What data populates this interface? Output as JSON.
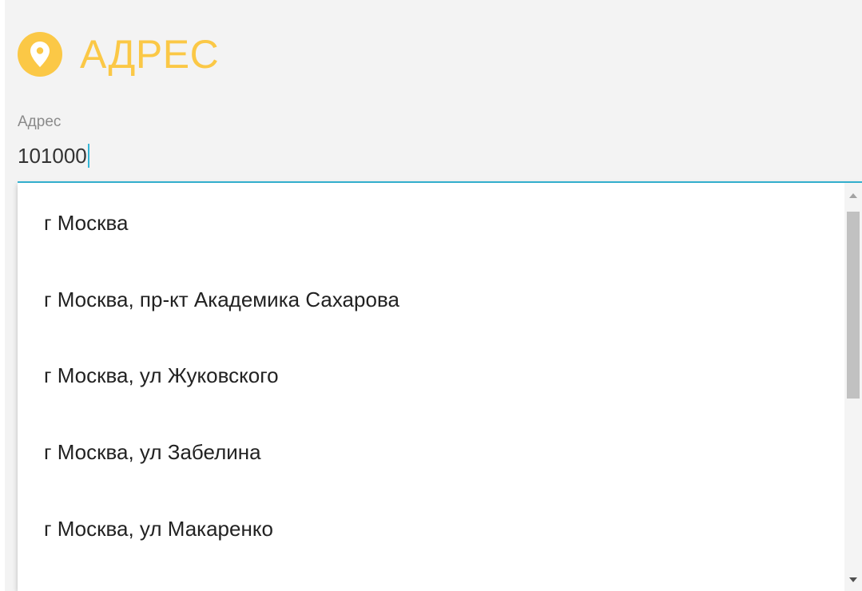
{
  "section": {
    "icon": "map-pin-icon",
    "title": "АДРЕС",
    "accent_color": "#fbc846"
  },
  "address_field": {
    "label": "Адрес",
    "value": "101000",
    "focus_color": "#35b6d6"
  },
  "suggestions": [
    {
      "label": "г Москва"
    },
    {
      "label": "г Москва, пр-кт Академика Сахарова"
    },
    {
      "label": "г Москва, ул Жуковского"
    },
    {
      "label": "г Москва, ул Забелина"
    },
    {
      "label": "г Москва, ул Макаренко"
    }
  ],
  "scrollbar": {
    "up_icon": "scroll-up-arrow-icon",
    "down_icon": "scroll-down-arrow-icon"
  }
}
